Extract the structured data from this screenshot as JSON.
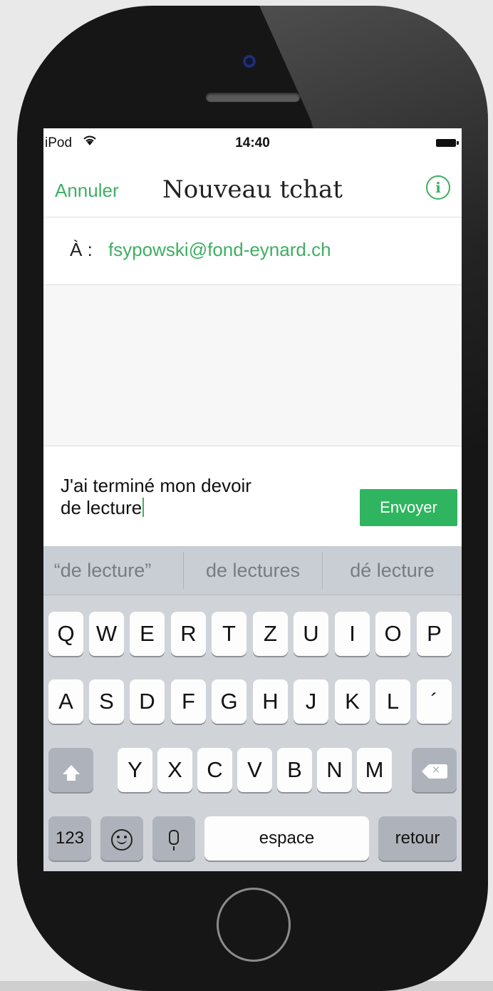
{
  "status_bar": {
    "device": "iPod",
    "wifi_icon": "wifi-icon",
    "time": "14:40",
    "battery_icon": "battery-icon"
  },
  "nav": {
    "cancel_label": "Annuler",
    "title": "Nouveau tchat",
    "info_icon": "info-icon"
  },
  "to_field": {
    "label": "À :",
    "value": "fsypowski@fond-eynard.ch"
  },
  "compose": {
    "text_line1": "J'ai terminé mon devoir",
    "text_line2": "de lecture",
    "send_label": "Envoyer"
  },
  "suggestions": [
    "“de lecture”",
    "de lectures",
    "dé lecture"
  ],
  "keyboard": {
    "row1": [
      "Q",
      "W",
      "E",
      "R",
      "T",
      "Z",
      "U",
      "I",
      "O",
      "P"
    ],
    "row2": [
      "A",
      "S",
      "D",
      "F",
      "G",
      "H",
      "J",
      "K",
      "L",
      "´"
    ],
    "row3": [
      "Y",
      "X",
      "C",
      "V",
      "B",
      "N",
      "M"
    ],
    "numbers_label": "123",
    "space_label": "espace",
    "return_label": "retour"
  },
  "colors": {
    "accent": "#3fae63",
    "send_button": "#2fb55f",
    "keyboard_bg": "#d0d4d9",
    "phone_body": "#161616"
  }
}
